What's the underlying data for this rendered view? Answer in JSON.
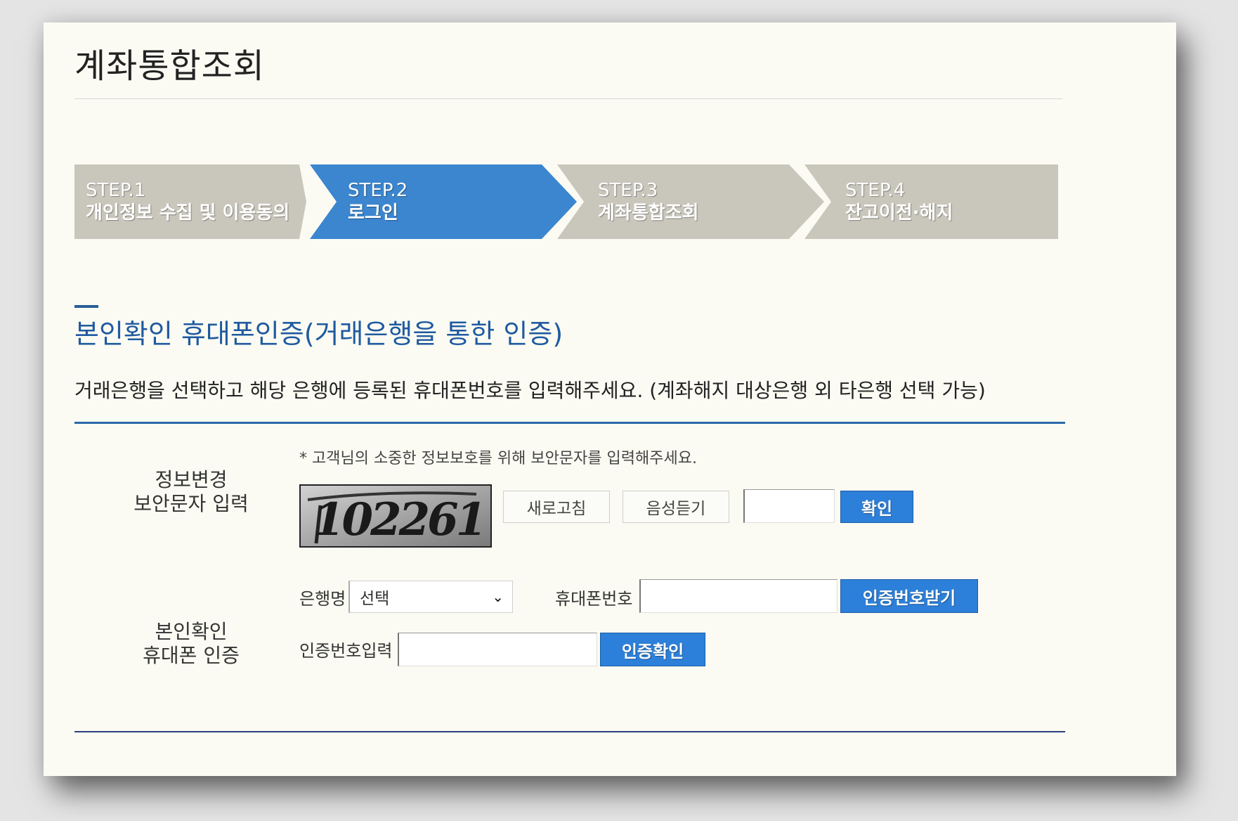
{
  "page": {
    "title": "계좌통합조회"
  },
  "steps": [
    {
      "num": "STEP.1",
      "label": "개인정보 수집 및 이용동의",
      "active": false
    },
    {
      "num": "STEP.2",
      "label": "로그인",
      "active": true
    },
    {
      "num": "STEP.3",
      "label": "계좌통합조회",
      "active": false
    },
    {
      "num": "STEP.4",
      "label": "잔고이전·해지",
      "active": false
    }
  ],
  "section": {
    "title": "본인확인 휴대폰인증(거래은행을 통한 인증)",
    "description": "거래은행을 선택하고 해당 은행에 등록된 휴대폰번호를 입력해주세요. (계좌해지 대상은행 외 타은행 선택 가능)"
  },
  "captcha": {
    "row_label_line1": "정보변경",
    "row_label_line2": "보안문자 입력",
    "note": "* 고객님의 소중한 정보보호를 위해 보안문자를 입력해주세요.",
    "image_text": "102261",
    "refresh_label": "새로고침",
    "audio_label": "음성듣기",
    "input_value": "",
    "confirm_label": "확인"
  },
  "phone_auth": {
    "row_label_line1": "본인확인",
    "row_label_line2": "휴대폰 인증",
    "bank_label": "은행명",
    "bank_selected": "선택",
    "phone_label": "휴대폰번호",
    "phone_value": "",
    "request_code_label": "인증번호받기",
    "code_label": "인증번호입력",
    "code_value": "",
    "verify_label": "인증확인"
  },
  "colors": {
    "accent": "#3b86cf",
    "step_inactive": "#c9c7bc",
    "section_title": "#1f5aa0",
    "card_bg": "#fbfbf3"
  }
}
